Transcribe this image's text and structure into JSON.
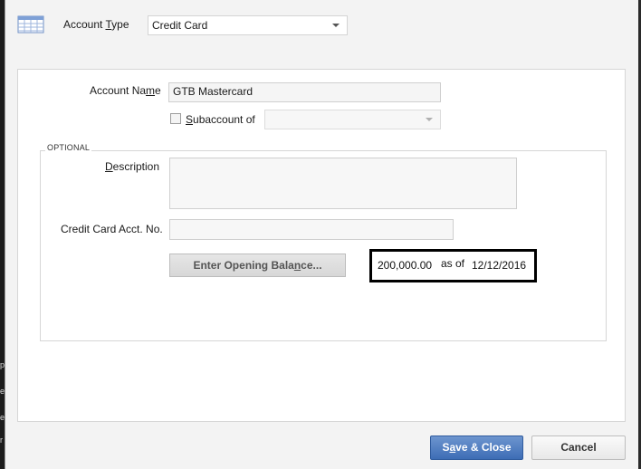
{
  "account_type": {
    "label_pre": "Account ",
    "label_ul": "T",
    "label_post": "ype",
    "value": "Credit Card"
  },
  "account_name": {
    "label_pre": "Account Na",
    "label_ul": "m",
    "label_post": "e",
    "value": "GTB Mastercard"
  },
  "subaccount": {
    "label_ul": "S",
    "label_post": "ubaccount of",
    "checked": false,
    "value": ""
  },
  "optional": {
    "title": "OPTIONAL"
  },
  "description": {
    "label_ul": "D",
    "label_post": "escription",
    "value": ""
  },
  "credit_card_no": {
    "label": "Credit Card Acct. No.",
    "value": ""
  },
  "opening_balance": {
    "button_pre": "Enter Opening Bala",
    "button_ul": "n",
    "button_post": "ce...",
    "amount": "200,000.00",
    "as_of_label": "as of",
    "date": "12/12/2016"
  },
  "buttons": {
    "save_pre": "S",
    "save_ul": "a",
    "save_post": "ve & Close",
    "cancel": "Cancel"
  },
  "colors": {
    "primary_button": "#3d6db5",
    "highlight_border": "#000000",
    "dialog_bg": "#f3f3f3"
  },
  "icons": {
    "account_type": "ledger-table-icon",
    "dropdown": "chevron-down-icon"
  }
}
